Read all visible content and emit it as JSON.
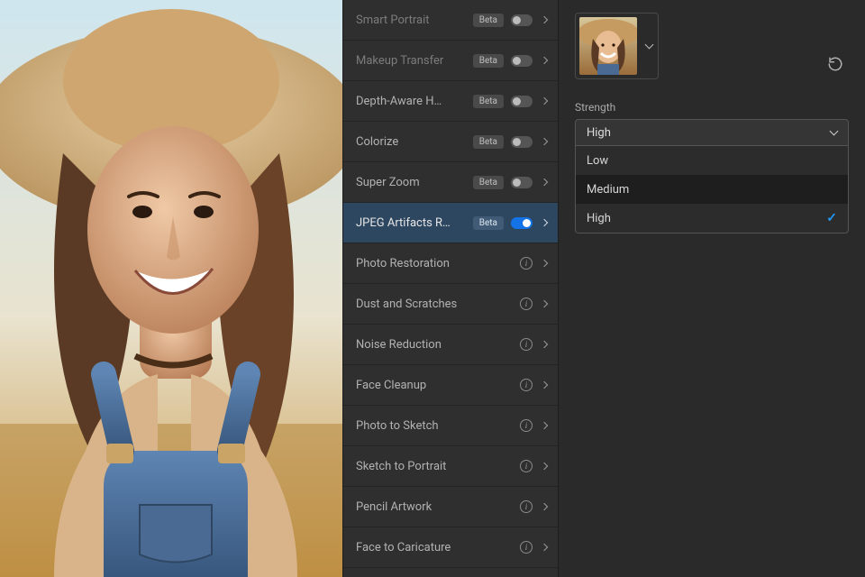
{
  "filters": [
    {
      "label": "Smart Portrait",
      "badge": "Beta",
      "toggle": "off",
      "dim": true
    },
    {
      "label": "Makeup Transfer",
      "badge": "Beta",
      "toggle": "off",
      "dim": true
    },
    {
      "label": "Depth-Aware H…",
      "badge": "Beta",
      "toggle": "off"
    },
    {
      "label": "Colorize",
      "badge": "Beta",
      "toggle": "off"
    },
    {
      "label": "Super Zoom",
      "badge": "Beta",
      "toggle": "off"
    },
    {
      "label": "JPEG Artifacts R…",
      "badge": "Beta",
      "toggle": "on",
      "active": true
    },
    {
      "label": "Photo Restoration",
      "info": true
    },
    {
      "label": "Dust and Scratches",
      "info": true
    },
    {
      "label": "Noise Reduction",
      "info": true
    },
    {
      "label": "Face Cleanup",
      "info": true
    },
    {
      "label": "Photo to Sketch",
      "info": true
    },
    {
      "label": "Sketch to Portrait",
      "info": true
    },
    {
      "label": "Pencil Artwork",
      "info": true
    },
    {
      "label": "Face to Caricature",
      "info": true
    }
  ],
  "detail": {
    "strength_label": "Strength",
    "selected": "High",
    "options": [
      "Low",
      "Medium",
      "High"
    ],
    "checked": "High"
  }
}
